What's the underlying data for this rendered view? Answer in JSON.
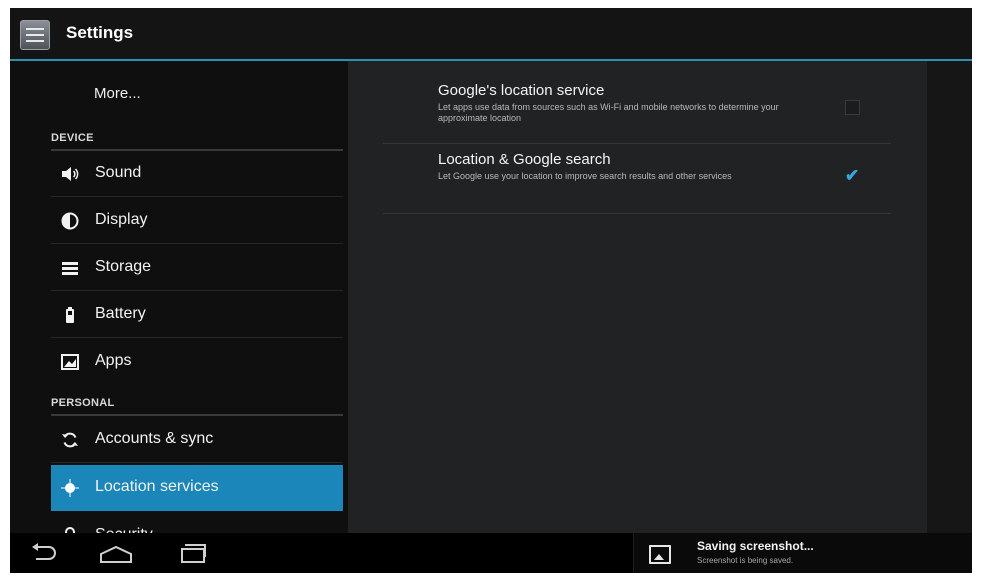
{
  "app": {
    "title": "Settings",
    "icon": "settings-app-icon"
  },
  "sidebar": {
    "more_label": "More...",
    "device_header": "DEVICE",
    "device_items": [
      {
        "label": "Sound",
        "icon": "volume-icon"
      },
      {
        "label": "Display",
        "icon": "display-icon"
      },
      {
        "label": "Storage",
        "icon": "storage-icon"
      },
      {
        "label": "Battery",
        "icon": "battery-icon"
      },
      {
        "label": "Apps",
        "icon": "apps-icon"
      }
    ],
    "personal_header": "PERSONAL",
    "personal_items": [
      {
        "label": "Accounts & sync",
        "icon": "sync-icon"
      },
      {
        "label": "Location services",
        "icon": "location-icon",
        "selected": true
      },
      {
        "label": "Security",
        "icon": "lock-icon"
      }
    ],
    "selected_color": "#1a86b9"
  },
  "location": {
    "items": [
      {
        "title": "Google's location service",
        "summary": "Let apps use data from sources such as Wi-Fi and mobile networks to determine your approximate location",
        "checked": false
      },
      {
        "title": "Location & Google search",
        "summary": "Let Google use your location to improve search results and other services",
        "checked": true
      }
    ]
  },
  "navbar": {
    "buttons": [
      "back-icon",
      "home-icon",
      "recent-apps-icon"
    ],
    "notification": {
      "title": "Saving screenshot...",
      "subtitle": "Screenshot is being saved."
    }
  },
  "colors": {
    "accent": "#2e8fb0",
    "check": "#37a8dd"
  }
}
